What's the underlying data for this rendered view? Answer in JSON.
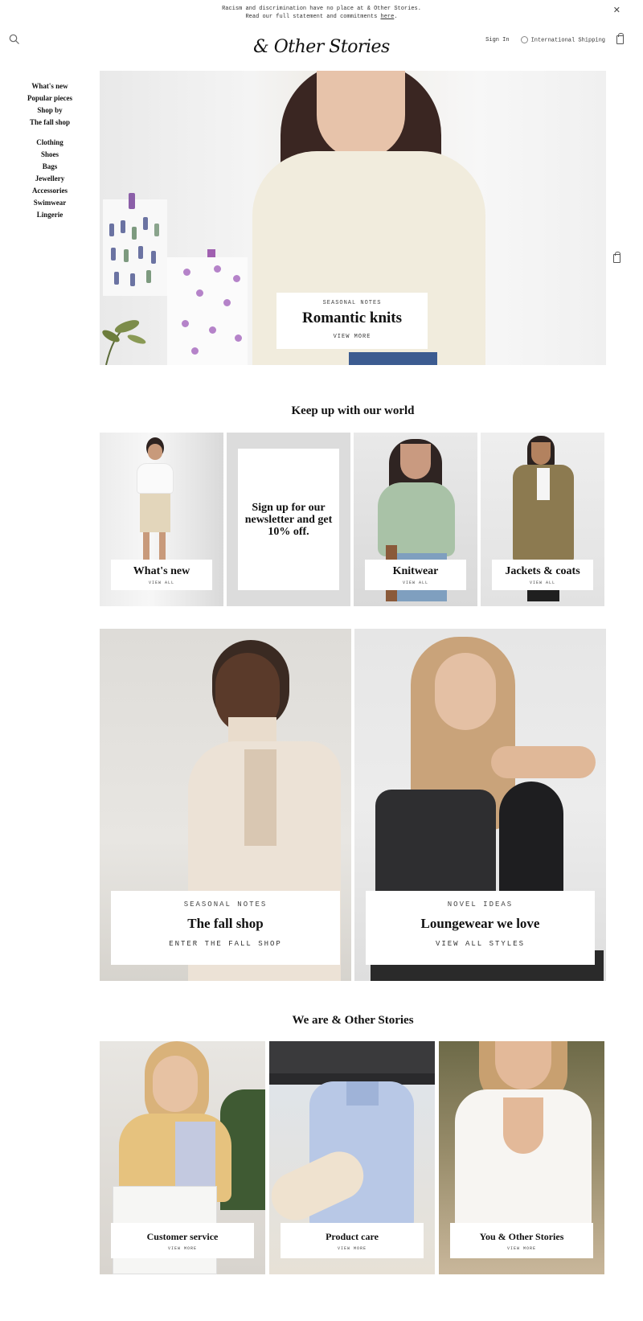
{
  "announcement": {
    "line1": "Racism and discrimination have no place at & Other Stories.",
    "line2_prefix": "Read our full statement and commitments ",
    "line2_link": "here",
    "line2_suffix": "."
  },
  "header": {
    "logo": "& Other Stories",
    "sign_in": "Sign In",
    "shipping": "International Shipping"
  },
  "nav": {
    "group1": [
      "What's new",
      "Popular pieces",
      "Shop by",
      "The fall shop"
    ],
    "group2": [
      "Clothing",
      "Shoes",
      "Bags",
      "Jewellery",
      "Accessories",
      "Swimwear",
      "Lingerie"
    ]
  },
  "hero": {
    "eyebrow": "SEASONAL NOTES",
    "title": "Romantic knits",
    "cta": "VIEW MORE"
  },
  "world": {
    "title": "Keep up with our world",
    "tiles": [
      {
        "title": "What's new",
        "cta": "VIEW ALL"
      },
      {
        "newsletter": "Sign up for our newsletter and get 10% off."
      },
      {
        "title": "Knitwear",
        "cta": "VIEW ALL"
      },
      {
        "title": "Jackets & coats",
        "cta": "VIEW ALL"
      }
    ]
  },
  "features": [
    {
      "eyebrow": "SEASONAL NOTES",
      "title": "The fall shop",
      "cta": "ENTER THE FALL SHOP"
    },
    {
      "eyebrow": "NOVEL IDEAS",
      "title": "Loungewear we love",
      "cta": "VIEW ALL STYLES"
    }
  ],
  "about": {
    "title": "We are & Other Stories",
    "tiles": [
      {
        "title": "Customer service",
        "cta": "VIEW MORE"
      },
      {
        "title": "Product care",
        "cta": "VIEW MORE"
      },
      {
        "title": "You & Other Stories",
        "cta": "VIEW MORE"
      }
    ]
  }
}
